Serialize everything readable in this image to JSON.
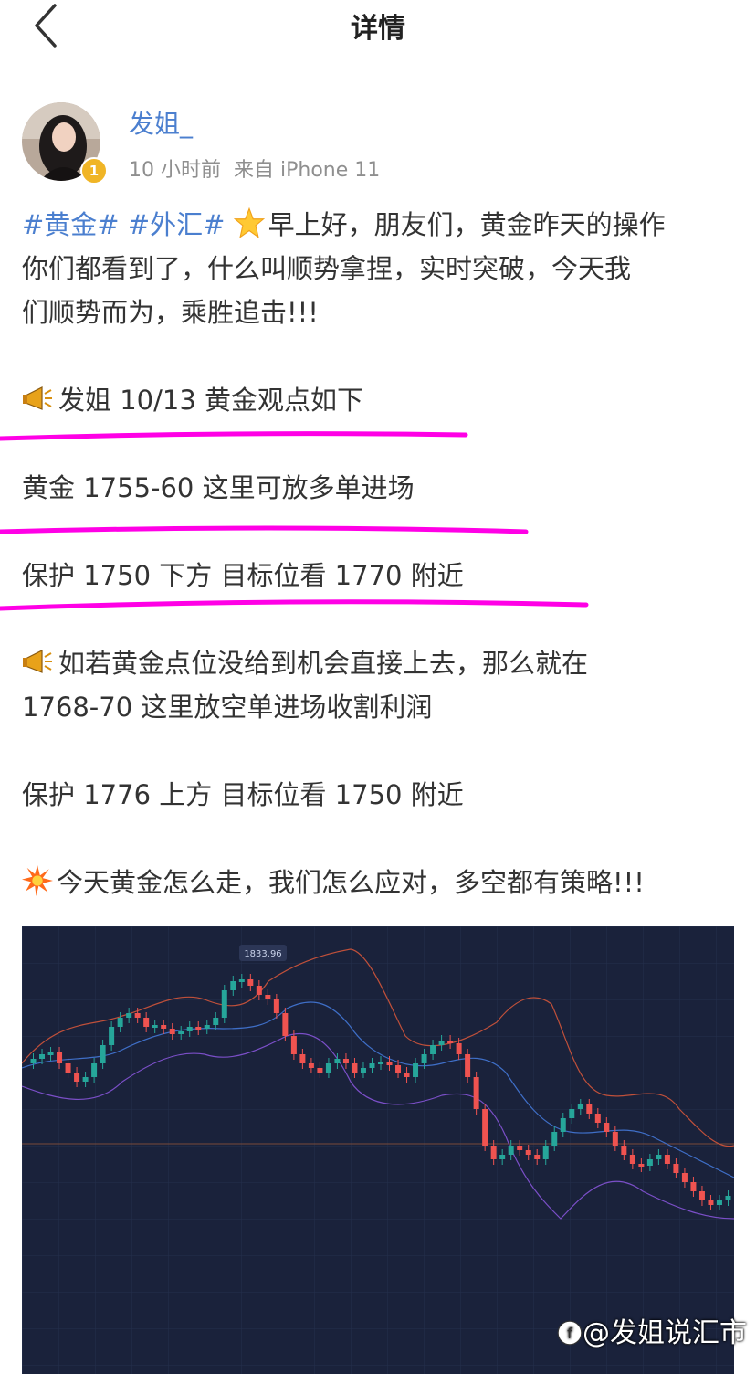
{
  "header": {
    "title": "详情"
  },
  "post": {
    "username": "发姐_",
    "badge_level": "1",
    "time": "10 小时前",
    "source": "来自 iPhone 11",
    "tags": [
      "#黄金#",
      "#外汇#"
    ],
    "intro_line1": "早上好，朋友们，黄金昨天的操作",
    "intro_line2": "你们都看到了，什么叫顺势拿捏，实时突破，今天我",
    "intro_line3": "们顺势而为，乘胜追击!!!",
    "view_title": "发姐 10/13 黄金观点如下",
    "long_entry": "黄金 1755-60 这里可放多单进场",
    "long_protect": "保护 1750 下方  目标位看 1770 附近",
    "alt_line1": "如若黄金点位没给到机会直接上去，那么就在",
    "alt_line2": "1768-70 这里放空单进场收割利润",
    "short_protect": "保护 1776 上方   目标位看 1750 附近",
    "closing": "今天黄金怎么走，我们怎么应对，多空都有策略!!!"
  },
  "chart": {
    "price_label": "1833.96"
  },
  "watermark": "@发姐说汇市",
  "colors": {
    "accent": "#4b7fcf",
    "highlight": "#ff00e6",
    "chart_bg": "#1a223b",
    "candle_up": "#26a69a",
    "candle_down": "#ef5350"
  }
}
